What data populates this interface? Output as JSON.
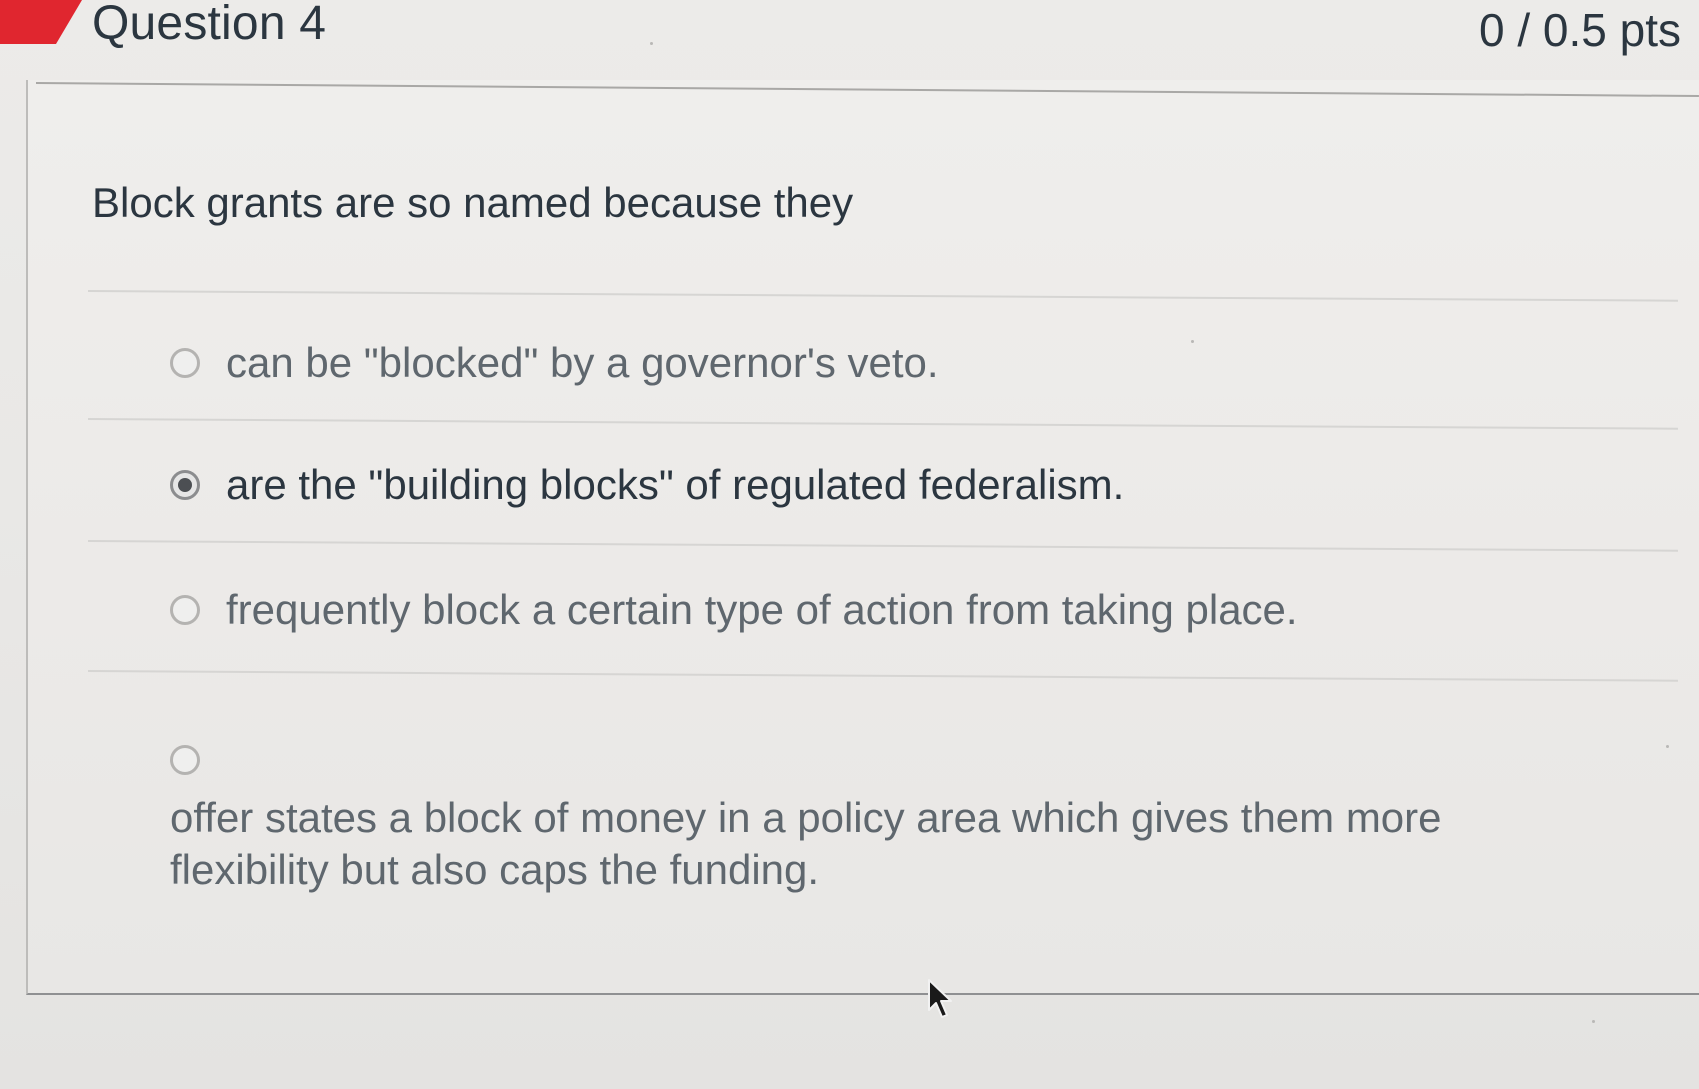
{
  "question": {
    "title": "Question 4",
    "score": "0 / 0.5 pts",
    "prompt": "Block grants are so named because they"
  },
  "answers": [
    {
      "label": "can be \"blocked\" by a governor's veto.",
      "selected": false
    },
    {
      "label": "are the \"building blocks\" of regulated federalism.",
      "selected": true
    },
    {
      "label": "frequently block a certain type of action from taking place.",
      "selected": false
    },
    {
      "label": "offer states a block of money in a policy area which gives them more flexibility but also caps the funding.",
      "selected": false
    }
  ],
  "colors": {
    "flag": "#e0262f",
    "text": "#2b3640",
    "muted_text": "#5f676e",
    "background": "#ecebe9"
  },
  "icons": {
    "cursor": "arrow-cursor-icon",
    "flag": "incorrect-flag-icon"
  }
}
